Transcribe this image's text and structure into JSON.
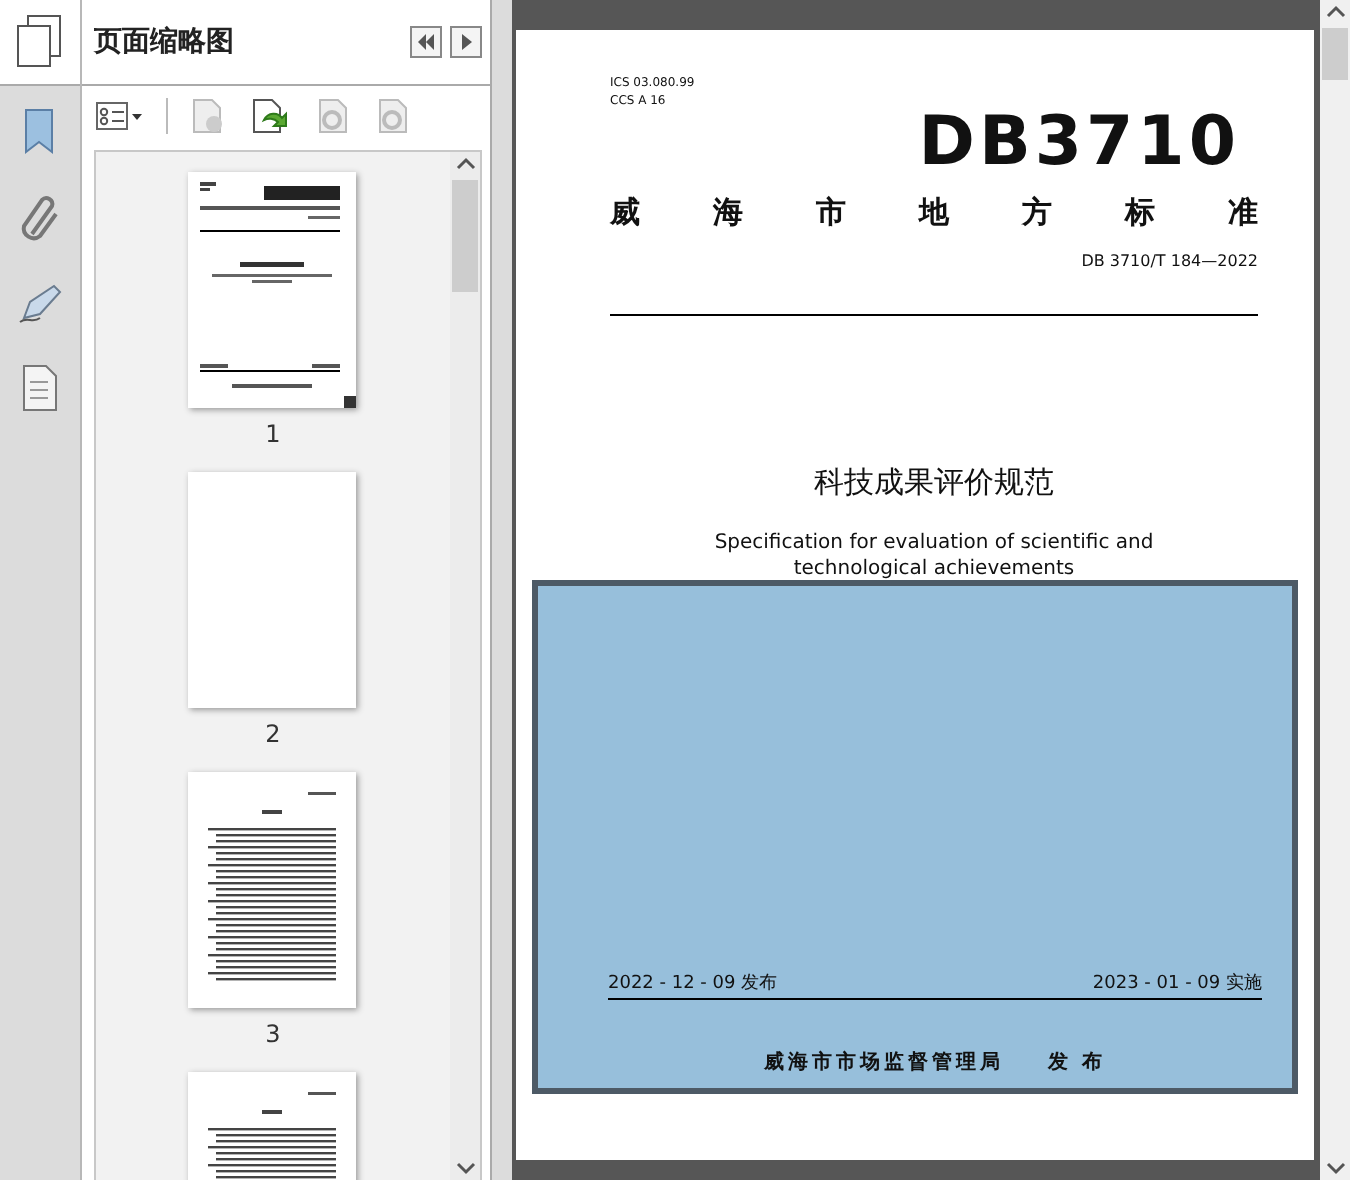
{
  "panel": {
    "title": "页面缩略图"
  },
  "thumbnails": [
    {
      "kind": "cover",
      "label": "1"
    },
    {
      "kind": "blank",
      "label": "2"
    },
    {
      "kind": "toc",
      "label": "3"
    },
    {
      "kind": "toc"
    }
  ],
  "page": {
    "ics": "ICS 03.080.99",
    "ccs": "CCS A 16",
    "code": "DB3710",
    "category": "威海市地方标准",
    "number": "DB 3710/T 184—2022",
    "title": "科技成果评价规范",
    "subtitle": "Specification for evaluation of scientific and technological achievements",
    "issue_date": "2022 - 12 - 09 发布",
    "effective_date": "2023 - 01 - 09 实施",
    "publisher": "威海市市场监督管理局",
    "publish": "发 布"
  }
}
